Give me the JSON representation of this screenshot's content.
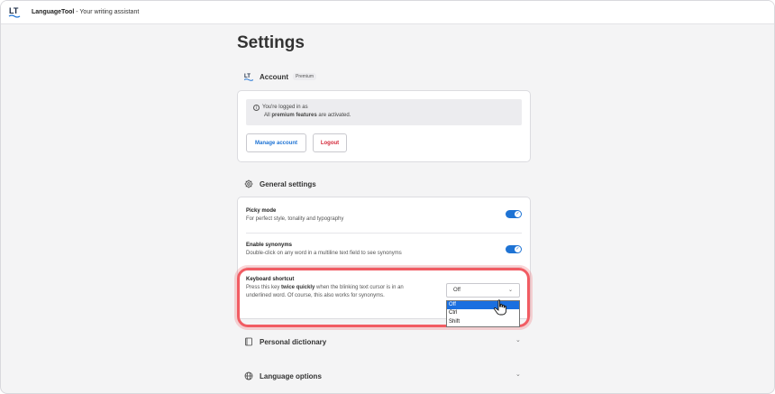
{
  "window": {
    "app_name": "LanguageTool",
    "subtitle": " - Your writing assistant",
    "logo_text": "LT"
  },
  "page": {
    "title": "Settings"
  },
  "account": {
    "heading": "Account",
    "badge": "Premium",
    "info_line1": "You're logged in as",
    "info_line2_prefix": "All ",
    "info_line2_bold": "premium features",
    "info_line2_suffix": " are activated.",
    "manage_label": "Manage account",
    "logout_label": "Logout"
  },
  "general": {
    "heading": "General settings",
    "picky_title": "Picky mode",
    "picky_desc": "For perfect style, tonality and typography",
    "picky_on": true,
    "synonyms_title": "Enable synonyms",
    "synonyms_desc": "Double-click on any word in a multiline text field to see synonyms",
    "synonyms_on": true,
    "shortcut_title": "Keyboard shortcut",
    "shortcut_desc_prefix": "Press this key ",
    "shortcut_desc_bold": "twice quickly",
    "shortcut_desc_suffix": " when the blinking text cursor is in an",
    "shortcut_desc_line2": "underlined word. Of course, this also works for synonyms.",
    "shortcut_value": "Off",
    "shortcut_options": [
      "Off",
      "Ctrl",
      "Shift"
    ]
  },
  "sections": {
    "personal_dictionary": "Personal dictionary",
    "language_options": "Language options"
  },
  "colors": {
    "accent": "#1e73d4",
    "highlight": "#f15c63",
    "logout": "#d42a3a"
  },
  "icons": {
    "logo": "languagetool-logo-icon",
    "account": "languagetool-logo-icon",
    "general": "gear-icon",
    "dictionary": "book-icon",
    "language": "globe-icon",
    "info": "info-icon",
    "chevron": "chevron-down-icon",
    "cursor": "hand-pointer-icon"
  }
}
